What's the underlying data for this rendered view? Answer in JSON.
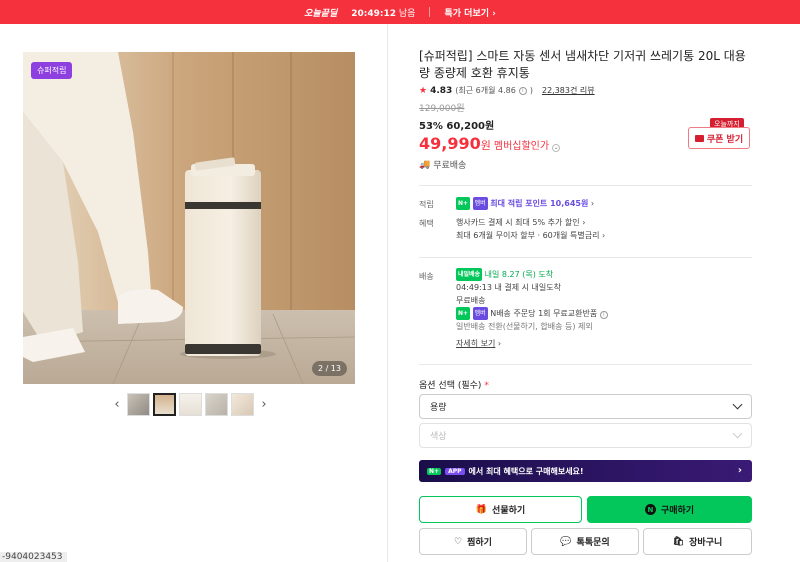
{
  "top_banner": {
    "badge": "오늘끝딜",
    "countdown": "20:49:12",
    "countdown_suffix": "남음",
    "more_link": "특가 더보기",
    "bg_color": "#f5313e"
  },
  "gallery": {
    "badge": "슈퍼적립",
    "counter": "2 / 13",
    "prev_icon": "chevron-left-icon",
    "next_icon": "chevron-right-icon",
    "thumbnail_count": 5,
    "active_index": 1
  },
  "product": {
    "title": "[슈퍼적립] 스마트 자동 센서 냄새차단 기저귀 쓰레기통 20L 대용량 종량제 호환 휴지통",
    "rating": "4.83",
    "rating_recent": "(최근 6개월 4.86",
    "rating_recent_close": ")",
    "review_count": "22,383건 리뷰",
    "original_price": "129,000원",
    "discount_percent": "53%",
    "sale_price": "60,200원",
    "member_price": "49,990",
    "member_price_unit": "원",
    "member_label": "멤버십할인가",
    "shipping_free": "무료배송"
  },
  "coupon": {
    "tag": "오늘까지",
    "label": "쿠폰 받기"
  },
  "benefits": {
    "points_label": "적립",
    "points_badge": "N+",
    "points_badge2": "멤버",
    "points_text": "최대 적립 포인트 10,645원",
    "promo_label": "혜택",
    "promo_line1": "행사카드 결제 시 최대 5% 추가 할인",
    "promo_line2": "최대 6개월 무이자 할부 · 60개월 특별금리"
  },
  "delivery": {
    "label": "배송",
    "badge": "내일배송",
    "arrival": "내일 8.27 (목) 도착",
    "cutoff": "04:49:13  내 결제 시 내일도착",
    "free": "무료배송",
    "return_text": "N배송 주문당 1회 무료교환반품",
    "exclusion": "일반배송 전환(선물하기, 합배송 등) 제외",
    "details_link": "자세히 보기"
  },
  "options": {
    "label": "옵션 선택 (필수)",
    "required_mark": "*",
    "select1_value": "용량",
    "select2_value": "색상"
  },
  "promo_banner": {
    "badge_n": "N+",
    "badge_app": "APP",
    "text": "에서 최대 혜택으로 구매해보세요!"
  },
  "actions": {
    "gift_label": "선물하기",
    "buy_label": "구매하기",
    "wish_label": "찜하기",
    "talk_label": "톡톡문의",
    "cart_label": "장바구니"
  },
  "footer_sku": "-9404023453",
  "colors": {
    "accent_red": "#f5313e",
    "naver_green": "#03c75a",
    "point_purple": "#6b4ce0"
  }
}
